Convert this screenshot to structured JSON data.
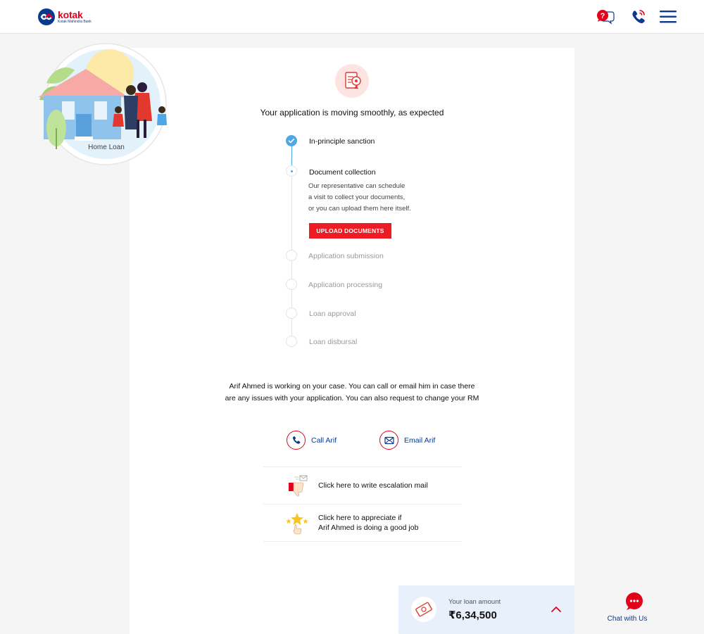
{
  "brand": {
    "name": "kotak",
    "subtitle": "Kotak Mahindra Bank",
    "colors": {
      "red": "#e2001a",
      "navy": "#0b3a8c",
      "accent_blue": "#4fa7e6"
    }
  },
  "header": {
    "icons": [
      "help-chat-icon",
      "phone-icon",
      "hamburger-menu-icon"
    ]
  },
  "product": {
    "label": "Home Loan"
  },
  "status": {
    "title": "Your application is moving smoothly, as expected"
  },
  "steps": [
    {
      "label": "In-principle sanction",
      "state": "completed"
    },
    {
      "label": "Document collection",
      "state": "current",
      "description": [
        "Our representative can schedule",
        "a visit to collect your documents,",
        "or you can upload them here itself."
      ],
      "action": "UPLOAD DOCUMENTS"
    },
    {
      "label": "Application submission",
      "state": "pending"
    },
    {
      "label": "Application processing",
      "state": "pending"
    },
    {
      "label": "Loan approval",
      "state": "pending"
    },
    {
      "label": "Loan disbursal",
      "state": "pending"
    }
  ],
  "rm": {
    "message_line1": "Arif Ahmed is working on your case. You can call or email him in case there",
    "message_line2": "are any issues with your application. You can also request to change your RM",
    "call_label": "Call Arif",
    "email_label": "Email Arif"
  },
  "feedback": {
    "escalation": "Click here to write escalation mail",
    "appreciate_line1": "Click here to appreciate if",
    "appreciate_line2": "Arif Ahmed is doing a good job"
  },
  "loan": {
    "label": "Your loan amount",
    "amount": "₹6,34,500"
  },
  "chat": {
    "label": "Chat with Us"
  }
}
